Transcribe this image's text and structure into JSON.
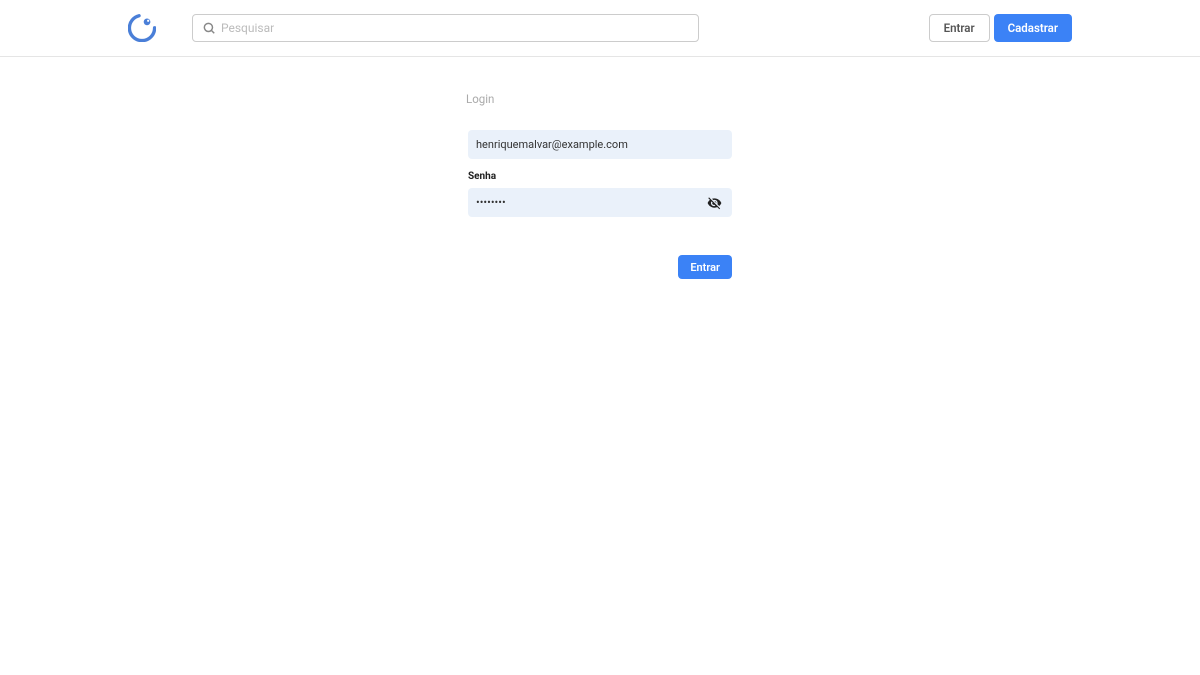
{
  "header": {
    "search_placeholder": "Pesquisar",
    "login_label": "Entrar",
    "signup_label": "Cadastrar"
  },
  "login": {
    "title": "Login",
    "email_value": "henriquemalvar@example.com",
    "password_label": "Senha",
    "password_value": "••••••••",
    "submit_label": "Entrar"
  }
}
